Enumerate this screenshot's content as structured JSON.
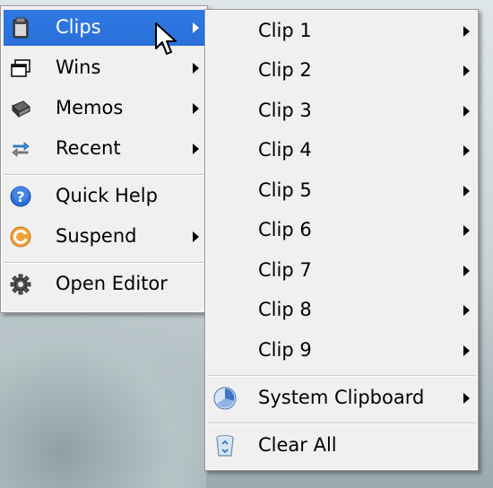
{
  "main_menu": {
    "items": [
      {
        "label": "Clips",
        "icon": "clipboard-icon",
        "has_submenu": true,
        "highlighted": true
      },
      {
        "label": "Wins",
        "icon": "windows-icon",
        "has_submenu": true
      },
      {
        "label": "Memos",
        "icon": "memo-icon",
        "has_submenu": true
      },
      {
        "label": "Recent",
        "icon": "recent-icon",
        "has_submenu": true
      },
      {
        "label": "Quick Help",
        "icon": "help-icon",
        "has_submenu": false
      },
      {
        "label": "Suspend",
        "icon": "suspend-icon",
        "has_submenu": true
      },
      {
        "label": "Open Editor",
        "icon": "gear-icon",
        "has_submenu": false
      }
    ]
  },
  "sub_menu": {
    "clips": [
      "Clip 1",
      "Clip 2",
      "Clip 3",
      "Clip 4",
      "Clip 5",
      "Clip 6",
      "Clip 7",
      "Clip 8",
      "Clip 9"
    ],
    "system_clipboard": "System Clipboard",
    "clear_all": "Clear All"
  },
  "colors": {
    "highlight": "#2a72dc",
    "menu_bg": "#f0f0f0"
  }
}
